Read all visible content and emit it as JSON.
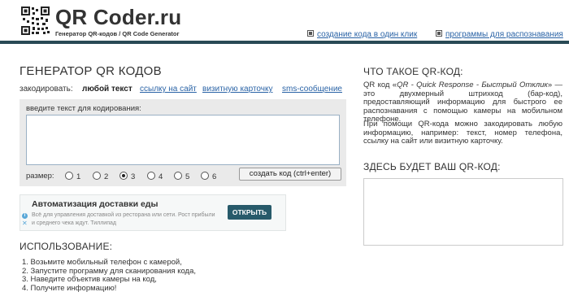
{
  "header": {
    "logo_title": "QR Coder.ru",
    "logo_subtitle": "Генератор QR-кодов / QR Code Generator",
    "links": [
      "создание кода в один клик",
      "программы для распознавания"
    ]
  },
  "generator": {
    "title": "ГЕНЕРАТОР QR КОДОВ",
    "encode_label": "закодировать:",
    "tabs": [
      "любой текст",
      "ссылку на сайт",
      "визитную карточку",
      "sms-сообщение"
    ],
    "active_tab": "любой текст",
    "textarea_label": "введите текст для кодирования:",
    "textarea_value": "",
    "size_label": "размер:",
    "sizes": [
      "1",
      "2",
      "3",
      "4",
      "5",
      "6"
    ],
    "selected_size": "3",
    "create_button": "создать код (ctrl+enter)"
  },
  "ad": {
    "title": "Автоматизация доставки еды",
    "text": "Всё для управления доставкой из ресторана или сети. Рост прибыли и среднего чека ждут. Тиллипад",
    "button": "ОТКРЫТЬ"
  },
  "usage": {
    "title": "ИСПОЛЬЗОВАНИЕ:",
    "steps": [
      "1. Возьмите мобильный телефон с камерой,",
      "2. Запустите программу для сканирования кода,",
      "3. Наведите объектив камеры на код,",
      "4. Получите информацию!"
    ]
  },
  "about": {
    "title": "ЧТО ТАКОЕ QR-КОД:",
    "p1_prefix": "QR код «",
    "p1_italic": "QR - Quick Response - Быстрый Отклик",
    "p1_rest": "» — это двухмерный штрихкод (бар-код), предоставляющий информацию для быстрого ее распознавания с помощью камеры на мобильном телефоне.",
    "p2": "При помощи QR-кода можно закодировать любую информацию, например: текст, номер телефона, ссылку на сайт или визитную карточку."
  },
  "result": {
    "title": "ЗДЕСЬ БУДЕТ ВАШ QR-КОД:"
  },
  "colors": {
    "header_line": "#294a55",
    "link": "#2a63a6",
    "panel_bg": "#eaeaea",
    "ad_button": "#275a6a"
  }
}
